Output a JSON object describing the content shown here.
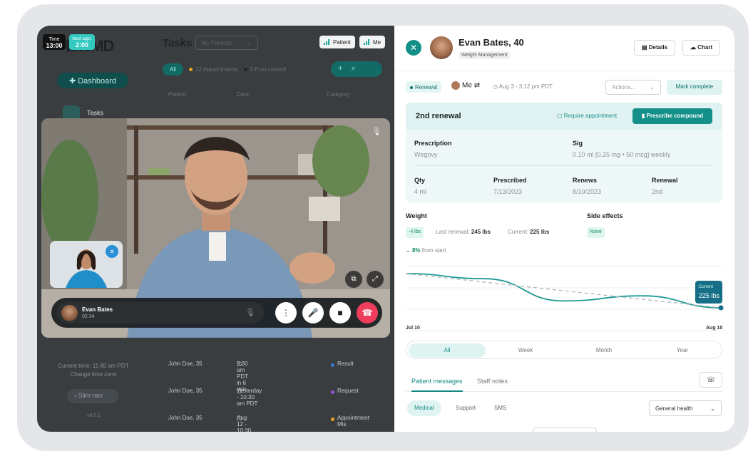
{
  "top": {
    "time_label": "Time",
    "time_value": "13:00",
    "next_label": "Next appt.",
    "next_value": "2:00",
    "logo": "LifeMD",
    "tasks_title": "Tasks",
    "patient_filter": "My Patients",
    "tag_patient": "Patient",
    "tag_me": "Me"
  },
  "sidebar": {
    "dashboard": "Dashboard",
    "tasks": "Tasks",
    "current_time": "Current time: 11:45 am PDT",
    "change_tz": "Change time zone",
    "slim_nav": "Slim nav",
    "version": "v0.0.1"
  },
  "filters": [
    {
      "label": "All",
      "active": true
    },
    {
      "label": "12 Appointments",
      "color": "#e8a020"
    },
    {
      "label": "2 Post-consult",
      "color": "#222222"
    }
  ],
  "table": {
    "headers": [
      "Patient",
      "Date",
      "Category"
    ],
    "rows": [
      {
        "patient": "John Doe, 35",
        "date": "9:30 am PDT in 6 min",
        "category": "Result",
        "cat_color": "#3b7ad6"
      },
      {
        "patient": "John Doe, 35",
        "date": "Yesterday - 10:30 am PDT",
        "category": "Request",
        "cat_color": "#9b55d6"
      },
      {
        "patient": "John Doe, 35",
        "date": "Aug 12 - 10:30 am PDT",
        "category": "Appointment Mis",
        "cat_color": "#e8a020"
      }
    ]
  },
  "call": {
    "name": "Evan Bates",
    "duration": "02:34"
  },
  "patient": {
    "name": "Evan Bates, 40",
    "program": "Weight Management",
    "details_btn": "Details",
    "chart_btn": "Chart"
  },
  "task": {
    "type": "Renewal",
    "assignee": "Me",
    "datetime": "Aug 3 - 3:12 pm PDT",
    "actions_placeholder": "Actions...",
    "mark_complete": "Mark complete"
  },
  "renewal_card": {
    "title": "2nd renewal",
    "require_appt": "Require appointment",
    "prescribe": "Prescribe compound",
    "prescription_label": "Prescription",
    "prescription": "Wegovy",
    "sig_label": "Sig",
    "sig": "0.10 ml [0.25 mg • 50 mcg] weekly",
    "qty_label": "Qty",
    "qty": "4 ml",
    "prescribed_label": "Prescribed",
    "prescribed": "7/13/2023",
    "renews_label": "Renews",
    "renews": "8/10/2023",
    "renewal_label": "Renewal",
    "renewal": "2nd"
  },
  "weight": {
    "title": "Weight",
    "delta": "-4 lbs",
    "last_label": "Last renewal:",
    "last_value": "245 lbs",
    "current_label": "Current:",
    "current_value": "225 lbs",
    "side_effects_title": "Side effects",
    "side_effects": "None",
    "from_start_pct": "8%",
    "from_start_label": "from start"
  },
  "chart_data": {
    "type": "line",
    "x": [
      "Jul 10",
      "Jul 17",
      "Jul 24",
      "Jul 31",
      "Aug 10"
    ],
    "xlabels_visible": [
      "Jul 10",
      "Aug 10"
    ],
    "series": [
      {
        "values": [
          245,
          242,
          229,
          232,
          225
        ],
        "color": "#1d9a93"
      },
      {
        "values": [
          245,
          240,
          235,
          230,
          225
        ],
        "color": "#b5b9bc",
        "dashed": true
      }
    ],
    "ylim": [
      220,
      250
    ],
    "annotation_label": "Current",
    "annotation_value": "225 lbs"
  },
  "range_tabs": [
    {
      "label": "All",
      "active": true
    },
    {
      "label": "Week"
    },
    {
      "label": "Month"
    },
    {
      "label": "Year"
    }
  ],
  "message_tabs": [
    {
      "label": "Patient messages",
      "active": true
    },
    {
      "label": "Staff notes"
    }
  ],
  "sub_tabs": [
    {
      "label": "Medical",
      "active": true
    },
    {
      "label": "Support"
    },
    {
      "label": "SMS"
    }
  ],
  "general_health": "General health"
}
